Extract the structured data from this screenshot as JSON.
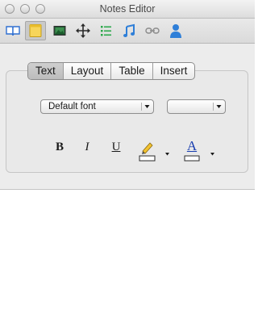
{
  "window": {
    "title": "Notes Editor"
  },
  "toolbar": {
    "items": [
      {
        "name": "book",
        "active": false
      },
      {
        "name": "note",
        "active": true
      },
      {
        "name": "image",
        "active": false
      },
      {
        "name": "move",
        "active": false
      },
      {
        "name": "list",
        "active": false
      },
      {
        "name": "music",
        "active": false
      },
      {
        "name": "link",
        "active": false
      },
      {
        "name": "person",
        "active": false
      }
    ]
  },
  "tabs": {
    "items": [
      "Text",
      "Layout",
      "Table",
      "Insert"
    ],
    "selected": "Text"
  },
  "font": {
    "family_value": "Default font",
    "size_value": ""
  },
  "format": {
    "bold_label": "B",
    "italic_label": "I",
    "underline_label": "U",
    "highlight_color": "#ffffff",
    "text_color_label": "A",
    "text_color": "#1a3fb0"
  },
  "colors": {
    "accent_yellow": "#f7d55a",
    "accent_blue": "#2f7fd8",
    "accent_green": "#2aa84a"
  }
}
